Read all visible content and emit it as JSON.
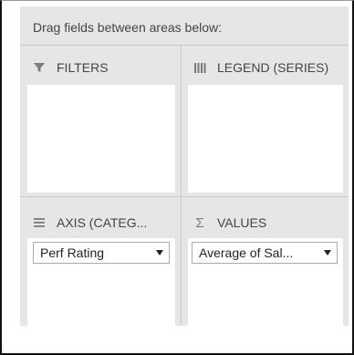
{
  "instruction": "Drag fields between areas below:",
  "areas": {
    "filters": {
      "label": "FILTERS",
      "icon": "filter-icon"
    },
    "legend": {
      "label": "LEGEND (SERIES)",
      "icon": "columns-icon"
    },
    "axis": {
      "label": "AXIS (CATEG...",
      "icon": "rows-icon",
      "field": "Perf Rating"
    },
    "values": {
      "label": "VALUES",
      "icon": "sigma-icon",
      "field": "Average of Sal..."
    }
  },
  "colors": {
    "panel_bg": "#e6e6e6",
    "box_bg": "#ffffff",
    "text": "#444444"
  }
}
